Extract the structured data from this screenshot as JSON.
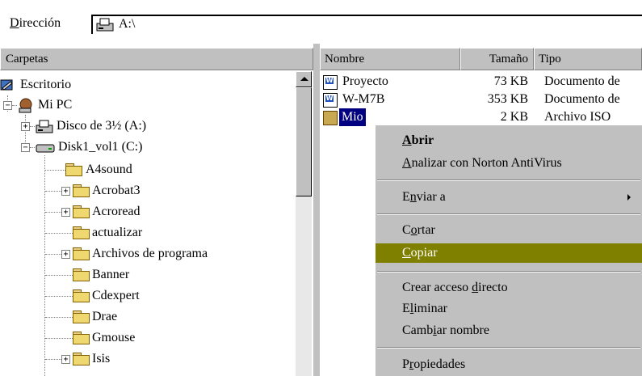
{
  "address": {
    "label_accel": "D",
    "label_rest": "irección",
    "path": "A:\\",
    "icon": "floppy-drive-icon"
  },
  "left_pane": {
    "header": "Carpetas",
    "items": [
      {
        "label": "Escritorio",
        "icon": "desktop-icon"
      },
      {
        "label": "Mi PC",
        "icon": "my-computer-icon"
      },
      {
        "label": "Disco de 3½ (A:)",
        "icon": "floppy-drive-icon"
      },
      {
        "label": "Disk1_vol1 (C:)",
        "icon": "hard-drive-icon"
      },
      {
        "label": "A4sound",
        "icon": "folder-icon"
      },
      {
        "label": "Acrobat3",
        "icon": "folder-icon"
      },
      {
        "label": "Acroread",
        "icon": "folder-icon"
      },
      {
        "label": "actualizar",
        "icon": "folder-icon"
      },
      {
        "label": "Archivos de programa",
        "icon": "folder-icon"
      },
      {
        "label": "Banner",
        "icon": "folder-icon"
      },
      {
        "label": "Cdexpert",
        "icon": "folder-icon"
      },
      {
        "label": "Drae",
        "icon": "folder-icon"
      },
      {
        "label": "Gmouse",
        "icon": "folder-icon"
      },
      {
        "label": "Isis",
        "icon": "folder-icon"
      }
    ]
  },
  "right_pane": {
    "columns": [
      "Nombre",
      "Tamaño",
      "Tipo"
    ],
    "files": [
      {
        "name": "Proyecto",
        "size": "73 KB",
        "type": "Documento de",
        "icon": "word-document-icon"
      },
      {
        "name": "W-M7B",
        "size": "353 KB",
        "type": "Documento de",
        "icon": "word-document-icon"
      },
      {
        "name": "Mio",
        "size": "2 KB",
        "type": "Archivo ISO",
        "icon": "iso-file-icon"
      }
    ]
  },
  "context_menu": {
    "items": [
      {
        "accel": "A",
        "rest": "brir"
      },
      {
        "accel": "A",
        "rest": "nalizar con Norton AntiVirus"
      },
      {
        "pre": "E",
        "accel": "n",
        "rest": "viar a"
      },
      {
        "pre": "C",
        "accel": "o",
        "rest": "rtar"
      },
      {
        "accel": "C",
        "rest": "opiar"
      },
      {
        "pre": "Crear acceso ",
        "accel": "d",
        "rest": "irecto"
      },
      {
        "pre": "E",
        "accel": "l",
        "rest": "iminar"
      },
      {
        "pre": "Camb",
        "accel": "i",
        "rest": "ar nombre"
      },
      {
        "pre": "P",
        "accel": "r",
        "rest": "opiedades"
      }
    ]
  },
  "colors": {
    "selection": "#000080",
    "menu_highlight": "#808000",
    "chrome": "#c0c0c0"
  }
}
